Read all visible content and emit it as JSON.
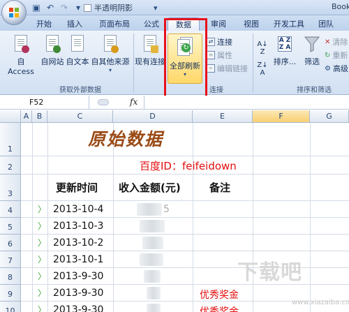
{
  "titlebar": {
    "checkbox_label": "半透明阴影",
    "app_name": "Book"
  },
  "tabs": [
    "开始",
    "插入",
    "页面布局",
    "公式",
    "数据",
    "审阅",
    "视图",
    "开发工具",
    "团队"
  ],
  "active_tab": "数据",
  "ribbon": {
    "get_external": {
      "buttons": [
        "自 Access",
        "自网站",
        "自文本",
        "自其他来源"
      ],
      "label": "获取外部数据"
    },
    "existing_conn": "现有连接",
    "refresh_all": "全部刷新",
    "connections": {
      "items": [
        "连接",
        "属性",
        "编辑链接"
      ],
      "label": "连接"
    },
    "sort_filter": {
      "sort": "排序...",
      "filter": "筛选",
      "small": [
        "清除",
        "重新",
        "高级"
      ],
      "label": "排序和筛选"
    }
  },
  "formula_bar": {
    "cell_ref": "F52",
    "fx": "fx",
    "content": ""
  },
  "columns": [
    "A",
    "B",
    "C",
    "D",
    "E",
    "F",
    "G"
  ],
  "selected_column": "F",
  "rows": [
    "1",
    "2",
    "3",
    "4",
    "5",
    "6",
    "7",
    "8",
    "9",
    "10"
  ],
  "sheet": {
    "title": "原始数据",
    "baidu": "百度ID：feifeidown",
    "headers": [
      "更新时间",
      "收入金额(元)",
      "备注"
    ],
    "dates": [
      "2013-10-4",
      "2013-10-3",
      "2013-10-2",
      "2013-10-1",
      "2013-9-30",
      "2013-9-30",
      "2013-9-30"
    ],
    "amount_visible": "5",
    "notes": [
      "",
      "",
      "",
      "",
      "",
      "优秀奖金",
      "优秀奖金"
    ]
  },
  "watermark": {
    "text": "下载吧",
    "url": "www.xiazaiba.com"
  },
  "colors": {
    "title": "#9a4a16",
    "red": "#e30e0e",
    "highlight": "#e8101a"
  }
}
